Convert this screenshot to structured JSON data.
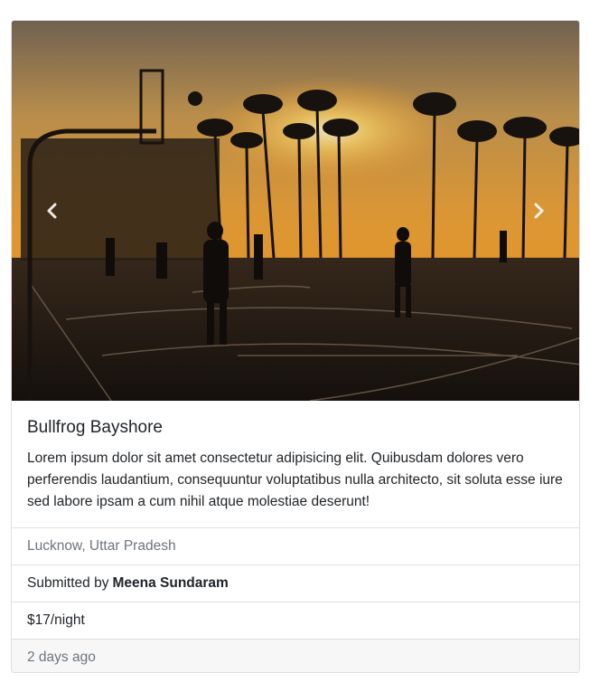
{
  "campground": {
    "title": "Bullfrog Bayshore",
    "description": "Lorem ipsum dolor sit amet consectetur adipisicing elit. Quibusdam dolores vero perferendis laudantium, consequuntur voluptatibus nulla architecto, sit soluta esse iure sed labore ipsam a cum nihil atque molestiae deserunt!",
    "location": "Lucknow, Uttar Pradesh",
    "submitted_prefix": "Submitted by",
    "author": "Meena Sundaram",
    "price": "$17/night",
    "posted": "2 days ago"
  },
  "carousel": {
    "prev_icon": "chevron-left-icon",
    "next_icon": "chevron-right-icon",
    "image": "basketball-court-sunset-photo"
  },
  "colors": {
    "border": "#dfdfdf",
    "muted_text": "#6c757d",
    "footer_bg": "#f7f7f7"
  }
}
